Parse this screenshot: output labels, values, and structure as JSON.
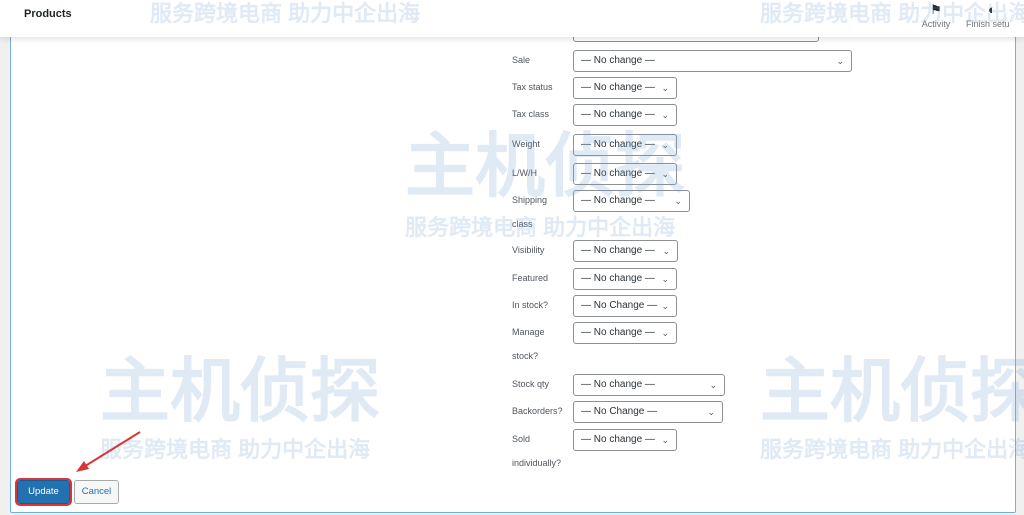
{
  "header": {
    "title": "Products",
    "activity": "Activity",
    "finish_setup": "Finish setu"
  },
  "fields": [
    {
      "label": "Sale",
      "value": "— No change —"
    },
    {
      "label": "Tax status",
      "value": "— No change —"
    },
    {
      "label": "Tax class",
      "value": "— No change —"
    },
    {
      "label": "Weight",
      "value": "— No change —"
    },
    {
      "label": "L/W/H",
      "value": "— No change —"
    },
    {
      "label": "Shipping",
      "label2": "class",
      "value": "— No change —"
    },
    {
      "label": "Visibility",
      "value": "— No change —"
    },
    {
      "label": "Featured",
      "value": "— No change —"
    },
    {
      "label": "In stock?",
      "value": "— No Change —"
    },
    {
      "label": "Manage",
      "label2": "stock?",
      "value": "— No change —"
    },
    {
      "label": "Stock qty",
      "value": "— No change —"
    },
    {
      "label": "Backorders?",
      "value": "— No Change —"
    },
    {
      "label": "Sold",
      "label2": "individually?",
      "value": "— No change —"
    }
  ],
  "buttons": {
    "update": "Update",
    "cancel": "Cancel"
  },
  "watermark": {
    "logo": "主机侦探",
    "slogan": "服务跨境电商 助力中企出海"
  },
  "colors": {
    "primary": "#2271b1",
    "highlight": "#d63638"
  }
}
